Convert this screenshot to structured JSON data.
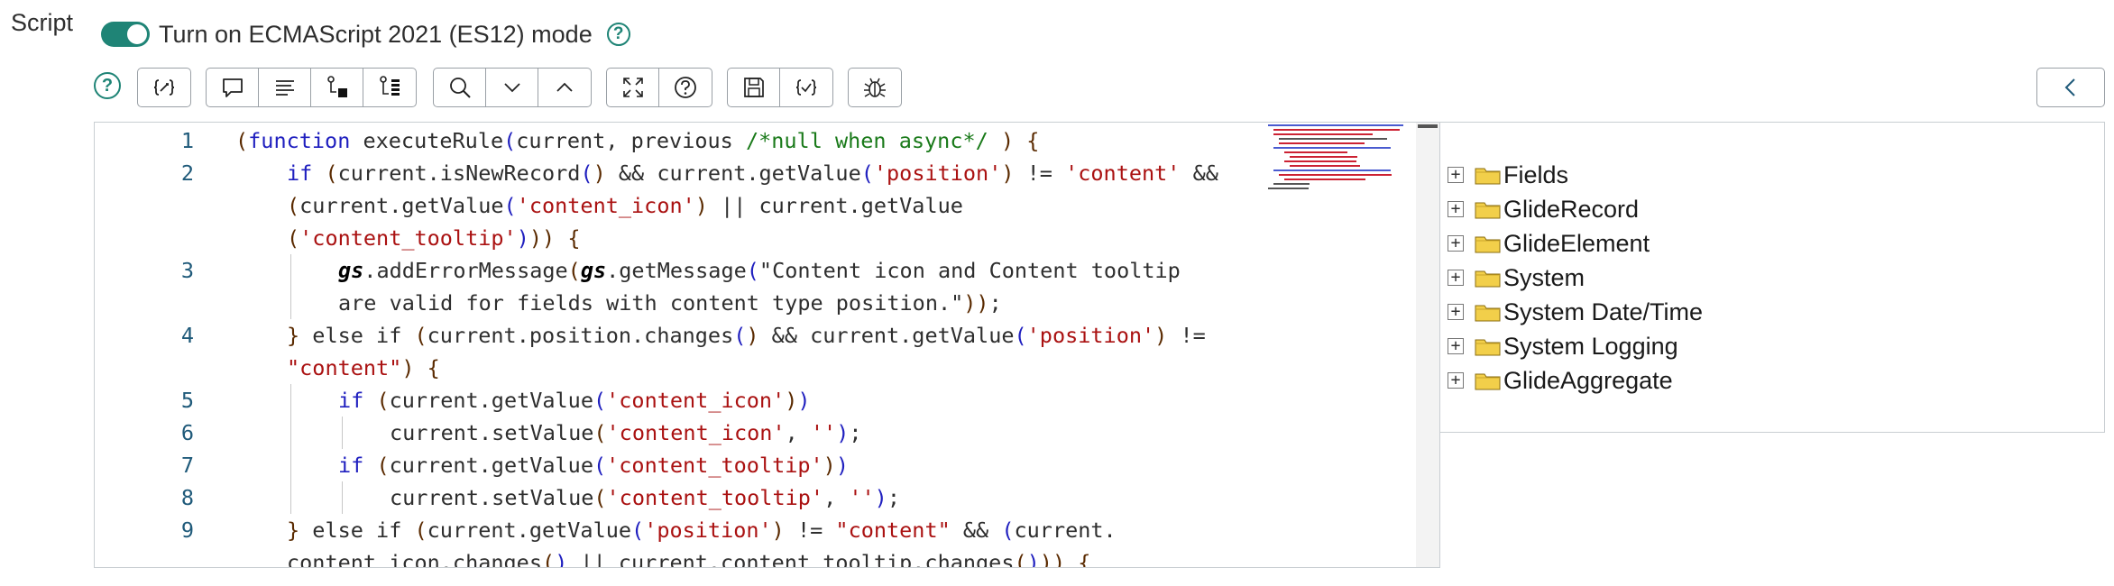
{
  "field": {
    "label": "Script",
    "toggle_label": "Turn on ECMAScript 2021 (ES12) mode",
    "toggle_state": "on",
    "help_symbol": "?"
  },
  "toolbar": {
    "help_symbol": "?",
    "groups": [
      {
        "buttons": [
          "format-code-icon"
        ]
      },
      {
        "buttons": [
          "comment-icon",
          "align-lines-icon",
          "insert-snippet-icon",
          "list-snippets-icon"
        ]
      },
      {
        "buttons": [
          "search-icon",
          "chevron-down-icon",
          "chevron-up-icon"
        ]
      },
      {
        "buttons": [
          "fullscreen-icon",
          "help-icon"
        ]
      },
      {
        "buttons": [
          "save-icon",
          "validate-script-icon"
        ]
      },
      {
        "buttons": [
          "debug-icon"
        ]
      }
    ],
    "collapse_icon": "chevron-left-icon"
  },
  "editor": {
    "lines": [
      {
        "num": "1",
        "text": "(function executeRule(current, previous /*null when async*/ ) {"
      },
      {
        "num": "2",
        "text": "if (current.isNewRecord() && current.getValue('position') != 'content' &&"
      },
      {
        "num": "",
        "text": "(current.getValue('content_icon') || current.getValue"
      },
      {
        "num": "",
        "text": "('content_tooltip'))) {"
      },
      {
        "num": "3",
        "text": "gs.addErrorMessage(gs.getMessage(\"Content icon and Content tooltip"
      },
      {
        "num": "",
        "text": "are valid for fields with content type position.\"));"
      },
      {
        "num": "4",
        "text": "} else if (current.position.changes() && current.getValue('position') !="
      },
      {
        "num": "",
        "text": "\"content\") {"
      },
      {
        "num": "5",
        "text": "if (current.getValue('content_icon'))"
      },
      {
        "num": "6",
        "text": "current.setValue('content_icon', '');"
      },
      {
        "num": "7",
        "text": "if (current.getValue('content_tooltip'))"
      },
      {
        "num": "8",
        "text": "current.setValue('content_tooltip', '');"
      },
      {
        "num": "9",
        "text": "} else if (current.getValue('position') != \"content\" && (current."
      },
      {
        "num": "",
        "text": "content_icon.changes() || current.content_tooltip.changes())) {"
      }
    ]
  },
  "tree": {
    "items": [
      {
        "label": "Fields"
      },
      {
        "label": "GlideRecord"
      },
      {
        "label": "GlideElement"
      },
      {
        "label": "System"
      },
      {
        "label": "System Date/Time"
      },
      {
        "label": "System Logging"
      },
      {
        "label": "GlideAggregate"
      }
    ],
    "expand_symbol": "+"
  },
  "colors": {
    "accent": "#1f8476",
    "keyword": "#1f1fbf",
    "string": "#aa1111",
    "comment": "#1a7a1a",
    "folder": "#f2cf4a"
  }
}
